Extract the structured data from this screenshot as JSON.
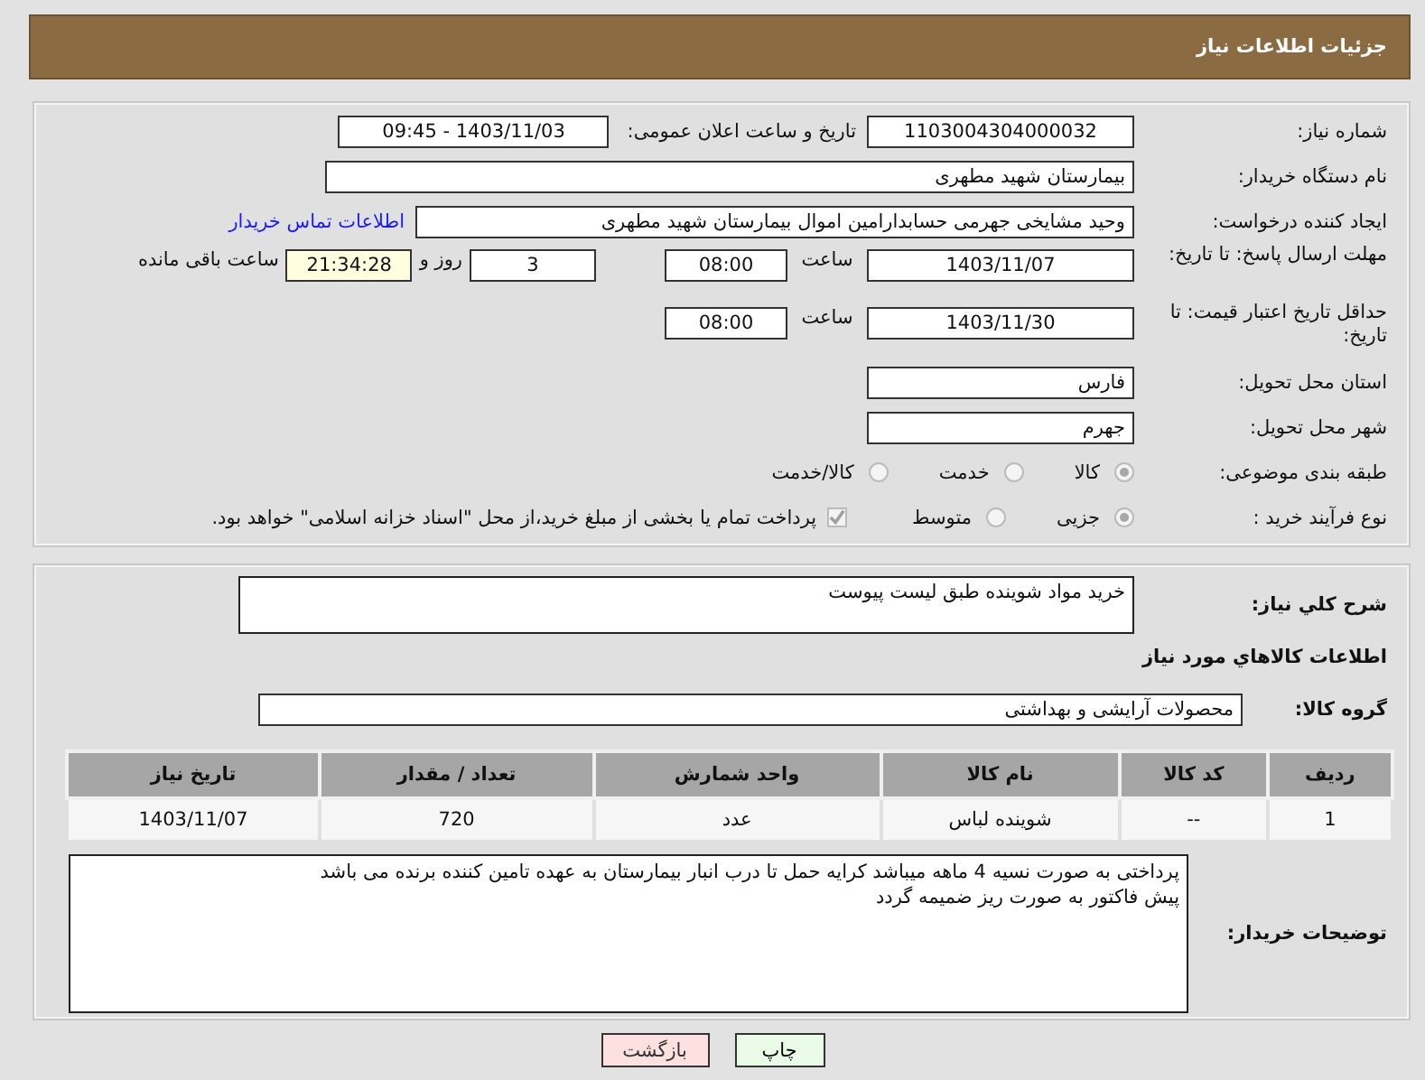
{
  "header": {
    "title": "جزئیات اطلاعات نیاز"
  },
  "details": {
    "need_number": {
      "label": "شماره نیاز:",
      "value": "1103004304000032"
    },
    "announce": {
      "label": "تاریخ و ساعت اعلان عمومی:",
      "value": "1403/11/03 - 09:45"
    },
    "buyer_org": {
      "label": "نام دستگاه خریدار:",
      "value": "بیمارستان شهید مطهری"
    },
    "requester": {
      "label": "ایجاد کننده درخواست:",
      "value": "وحید مشایخی جهرمی حسابدارامین اموال بیمارستان شهید مطهری",
      "link": "اطلاعات تماس خریدار"
    },
    "deadline": {
      "label": "مهلت ارسال پاسخ: تا تاریخ:",
      "date": "1403/11/07",
      "time_label": "ساعت",
      "time": "08:00",
      "days": "3",
      "days_label": "روز و",
      "remaining": "21:34:28",
      "remaining_label": "ساعت باقی مانده"
    },
    "validity": {
      "label": "حداقل تاریخ اعتبار قیمت: تا تاریخ:",
      "date": "1403/11/30",
      "time_label": "ساعت",
      "time": "08:00"
    },
    "province": {
      "label": "استان محل تحویل:",
      "value": "فارس"
    },
    "city": {
      "label": "شهر محل تحویل:",
      "value": "جهرم"
    },
    "category": {
      "label": "طبقه بندی موضوعی:",
      "options": [
        {
          "label": "کالا",
          "selected": true
        },
        {
          "label": "خدمت",
          "selected": false
        },
        {
          "label": "کالا/خدمت",
          "selected": false
        }
      ]
    },
    "process": {
      "label": "نوع فرآیند خرید :",
      "options": [
        {
          "label": "جزیی",
          "selected": true
        },
        {
          "label": "متوسط",
          "selected": false
        }
      ],
      "treasury": {
        "checked": true,
        "label": "پرداخت تمام یا بخشی از مبلغ خرید،از محل \"اسناد خزانه اسلامی\" خواهد بود."
      }
    }
  },
  "need": {
    "summary_label": "شرح کلي نياز:",
    "summary": "خرید مواد شوینده طبق لیست پیوست",
    "goods_heading": "اطلاعات کالاهاي مورد نياز",
    "group_label": "گروه کالا:",
    "group": "محصولات آرایشی و بهداشتی",
    "table": {
      "columns": [
        "ردیف",
        "کد کالا",
        "نام کالا",
        "واحد شمارش",
        "تعداد / مقدار",
        "تاریخ نیاز"
      ],
      "rows": [
        [
          "1",
          "--",
          "شوینده لباس",
          "عدد",
          "720",
          "1403/11/07"
        ]
      ]
    },
    "notes_label": "توضیحات خریدار:",
    "notes": [
      "پرداختی به صورت نسیه 4 ماهه میباشد کرایه حمل تا درب انبار بیمارستان به عهده تامین کننده برنده می باشد",
      "پیش فاکتور به صورت ریز ضمیمه گردد"
    ]
  },
  "buttons": [
    {
      "label": "چاپ",
      "kind": "print"
    },
    {
      "label": "بازگشت",
      "kind": "back"
    }
  ]
}
